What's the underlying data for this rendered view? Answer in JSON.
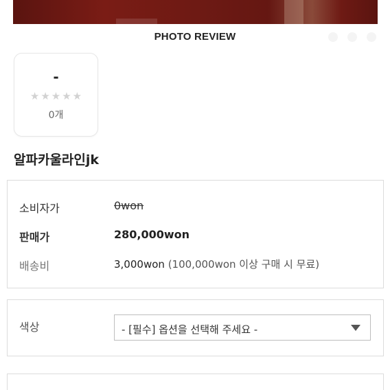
{
  "hero": {
    "icon": "product-photo"
  },
  "reviews": {
    "heading": "PHOTO REVIEW",
    "score": "-",
    "stars_filled": 0,
    "stars_total": 5,
    "count": "0개"
  },
  "product": {
    "name": "알파카울라인jk"
  },
  "pricing": {
    "retail_label": "소비자가",
    "retail_value": "0won",
    "sale_label": "판매가",
    "sale_value": "280,000won",
    "shipping_label": "배송비",
    "shipping_fee": "3,000won",
    "shipping_note": "(100,000won 이상 구매 시 무료)"
  },
  "options": {
    "color_label": "색상",
    "color_selected": "- [필수] 옵션을 선택해 주세요 -"
  },
  "colors": {
    "border": "#dcdcdc",
    "star_empty": "#d2d2d2",
    "text_dark": "#222222"
  }
}
